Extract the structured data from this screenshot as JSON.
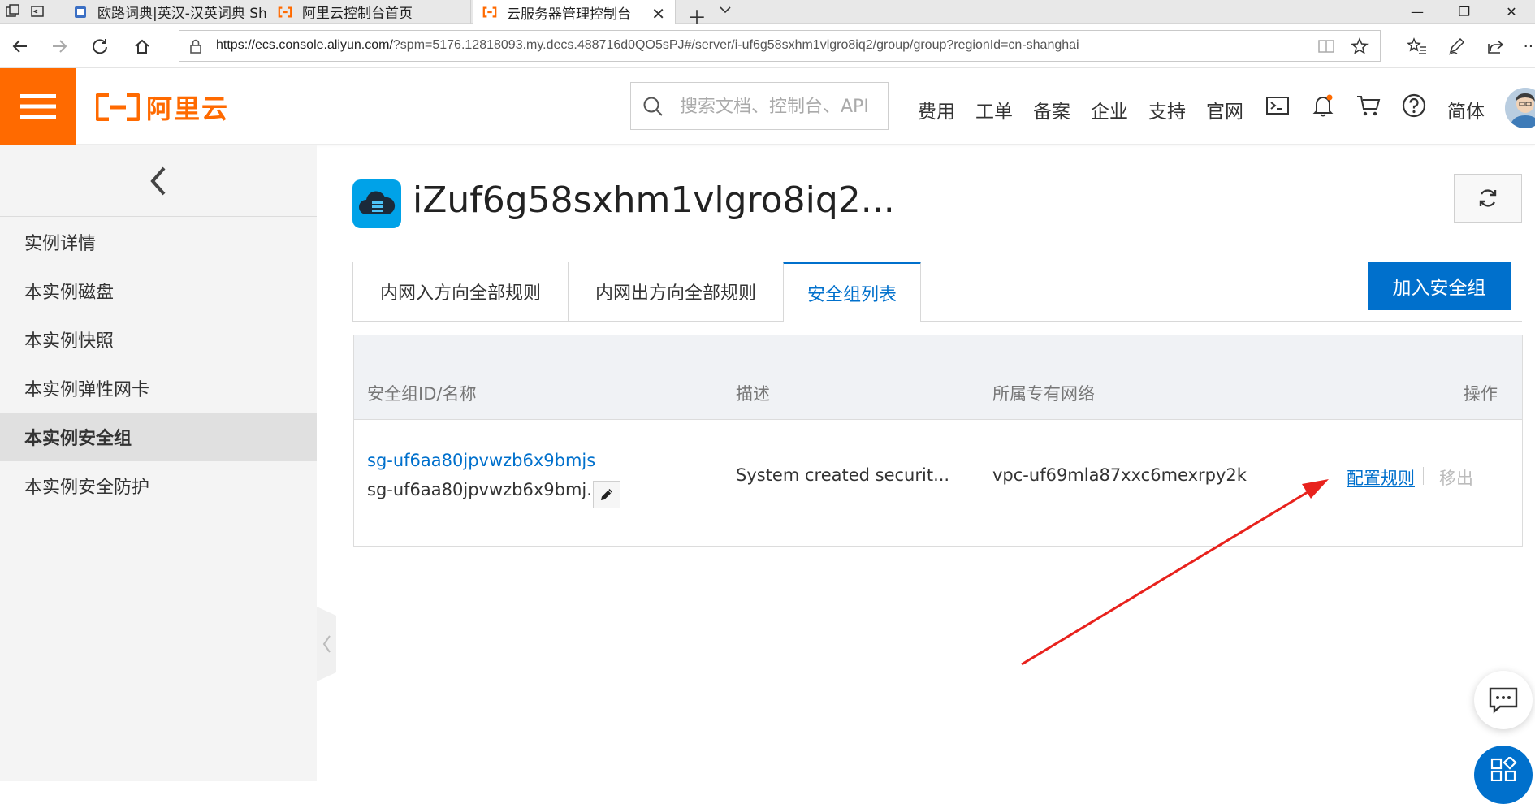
{
  "browser": {
    "tabs": [
      {
        "title": "欧路词典|英汉-汉英词典 Sh"
      },
      {
        "title": "阿里云控制台首页"
      },
      {
        "title": "云服务器管理控制台"
      }
    ],
    "url_host": "https://ecs.console.aliyun.com/",
    "url_rest": "?spm=5176.12818093.my.decs.488716d0QO5sPJ#/server/i-uf6g58sxhm1vlgro8iq2/group/group?regionId=cn-shanghai"
  },
  "header": {
    "logo_text": "阿里云",
    "search_placeholder": "搜索文档、控制台、API",
    "nav": [
      "费用",
      "工单",
      "备案",
      "企业",
      "支持",
      "官网"
    ],
    "language": "简体"
  },
  "sidebar": {
    "items": [
      {
        "label": "实例详情"
      },
      {
        "label": "本实例磁盘"
      },
      {
        "label": "本实例快照"
      },
      {
        "label": "本实例弹性网卡"
      },
      {
        "label": "本实例安全组",
        "active": true
      },
      {
        "label": "本实例安全防护"
      }
    ]
  },
  "main": {
    "instance_title": "iZuf6g58sxhm1vlgro8iq2...",
    "tabs": [
      {
        "label": "内网入方向全部规则"
      },
      {
        "label": "内网出方向全部规则"
      },
      {
        "label": "安全组列表",
        "active": true
      }
    ],
    "join_button": "加入安全组",
    "table": {
      "headers": [
        "安全组ID/名称",
        "描述",
        "所属专有网络",
        "操作"
      ],
      "rows": [
        {
          "id": "sg-uf6aa80jpvwzb6x9bmjs",
          "name": "sg-uf6aa80jpvwzb6x9bmj...",
          "description": "System created securit...",
          "vpc": "vpc-uf69mla87xxc6mexrpy2k",
          "action_configure": "配置规则",
          "action_remove": "移出"
        }
      ]
    }
  },
  "colors": {
    "brand_orange": "#ff6a00",
    "primary_blue": "#0070cc",
    "annotation_red": "#e8221d"
  }
}
